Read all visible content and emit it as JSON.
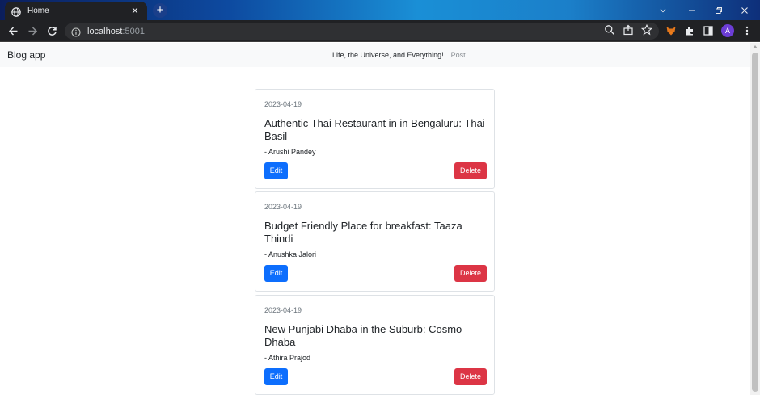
{
  "browser": {
    "tab_title": "Home",
    "tab_close_glyph": "✕",
    "new_tab_glyph": "+",
    "url_host": "localhost",
    "url_port": ":5001",
    "avatar_letter": "A",
    "icons": [
      "globe-icon",
      "back-icon",
      "forward-icon",
      "reload-icon",
      "info-icon",
      "zoom-icon",
      "share-icon",
      "star-icon",
      "fox-extension-icon",
      "puzzle-icon",
      "sidepanel-icon",
      "menu-icon",
      "minimize-icon",
      "restore-icon",
      "close-window-icon"
    ]
  },
  "app": {
    "brand": "Blog app",
    "nav_active": "Life, the Universe, and Everything!",
    "nav_post": "Post"
  },
  "posts": [
    {
      "date": "2023-04-19",
      "title": "Authentic Thai Restaurant in in Bengaluru: Thai Basil",
      "author": "- Arushi Pandey",
      "edit_label": "Edit",
      "delete_label": "Delete"
    },
    {
      "date": "2023-04-19",
      "title": "Budget Friendly Place for breakfast: Taaza Thindi",
      "author": "- Anushka Jalori",
      "edit_label": "Edit",
      "delete_label": "Delete"
    },
    {
      "date": "2023-04-19",
      "title": "New Punjabi Dhaba in the Suburb: Cosmo Dhaba",
      "author": "- Athira Prajod",
      "edit_label": "Edit",
      "delete_label": "Delete"
    }
  ],
  "colors": {
    "edit": "#0d6efd",
    "delete": "#dc3545",
    "chrome_dark": "#202124"
  }
}
